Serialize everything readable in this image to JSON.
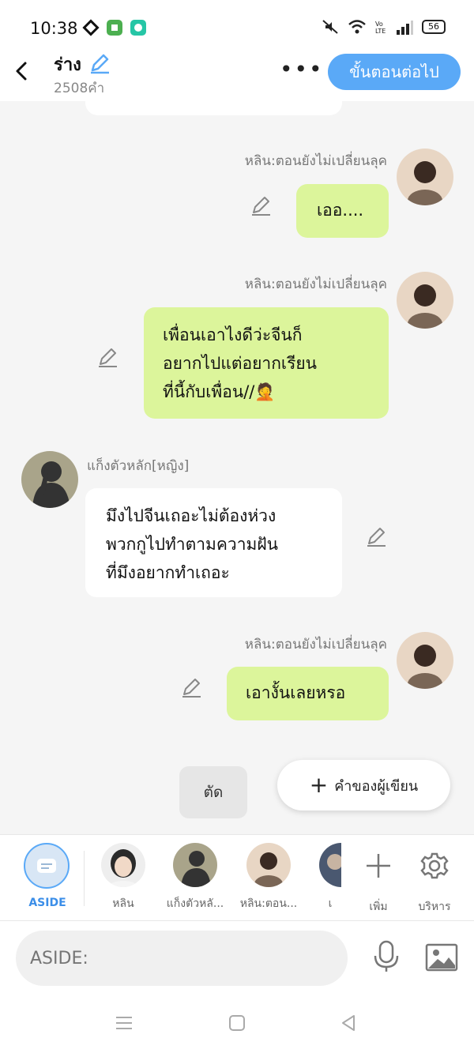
{
  "status": {
    "time": "10:38",
    "battery": "56"
  },
  "header": {
    "title": "ร่าง",
    "word_count": "2508คำ",
    "more": "•••",
    "next_label": "ขั้นตอนต่อไป"
  },
  "messages": [
    {
      "speaker": "หลิน:ตอนยังไม่เปลี่ยนลุค",
      "text": "เออ....",
      "side": "me"
    },
    {
      "speaker": "หลิน:ตอนยังไม่เปลี่ยนลุค",
      "lines": [
        "เพื่อนเอาไงดีว่ะจีนก็",
        "อยากไปแต่อยากเรียน",
        "ที่นี้กับเพื่อน//🤦"
      ],
      "side": "me"
    },
    {
      "speaker": "แก็งตัวหลัก[หญิง]",
      "lines": [
        "มึงไปจีนเถอะไม่ต้องห่วง",
        "พวกกูไปทำตามความฝัน",
        "ที่มึงอยากทำเถอะ"
      ],
      "side": "other"
    },
    {
      "speaker": "หลิน:ตอนยังไม่เปลี่ยนลุค",
      "text": "เอางั้นเลยหรอ",
      "side": "me"
    }
  ],
  "actions": {
    "cut_label": "ตัด",
    "author_label": "คำของผู้เขียน"
  },
  "characters": [
    {
      "label": "ASIDE",
      "icon": "aside-icon"
    },
    {
      "label": "หลิน"
    },
    {
      "label": "แก็งตัวหลั..."
    },
    {
      "label": "หลิน:ตอน..."
    },
    {
      "label": "เ"
    }
  ],
  "tools": {
    "add_label": "เพิ่ม",
    "manage_label": "บริหาร"
  },
  "input": {
    "placeholder": "ASIDE:"
  },
  "colors": {
    "accent": "#5aa9f7",
    "my_bubble": "#dcf59b",
    "other_bubble": "#ffffff"
  }
}
